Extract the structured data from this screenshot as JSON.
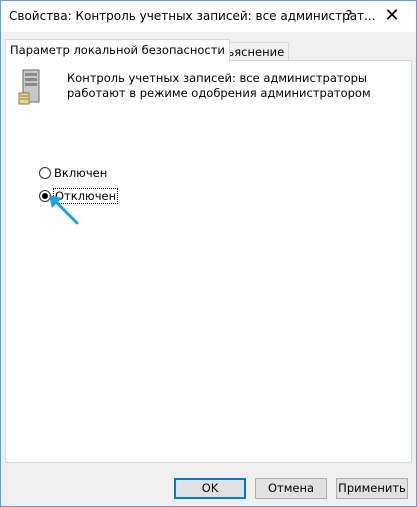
{
  "window": {
    "title": "Свойства: Контроль учетных записей: все администрат...",
    "help_label": "?",
    "close_label": "✕"
  },
  "tabs": [
    {
      "label": "Параметр локальной безопасности",
      "active": true
    },
    {
      "label": "Объяснение",
      "active": false
    }
  ],
  "policy": {
    "icon": "server-icon",
    "description": "Контроль учетных записей: все администраторы работают в режиме одобрения администратором"
  },
  "options": [
    {
      "label": "Включен",
      "checked": false
    },
    {
      "label": "Отключен",
      "checked": true
    }
  ],
  "buttons": {
    "ok": "OK",
    "cancel": "Отмена",
    "apply": "Применить"
  },
  "colors": {
    "accent": "#0078d7",
    "arrow": "#1ba1e2"
  }
}
